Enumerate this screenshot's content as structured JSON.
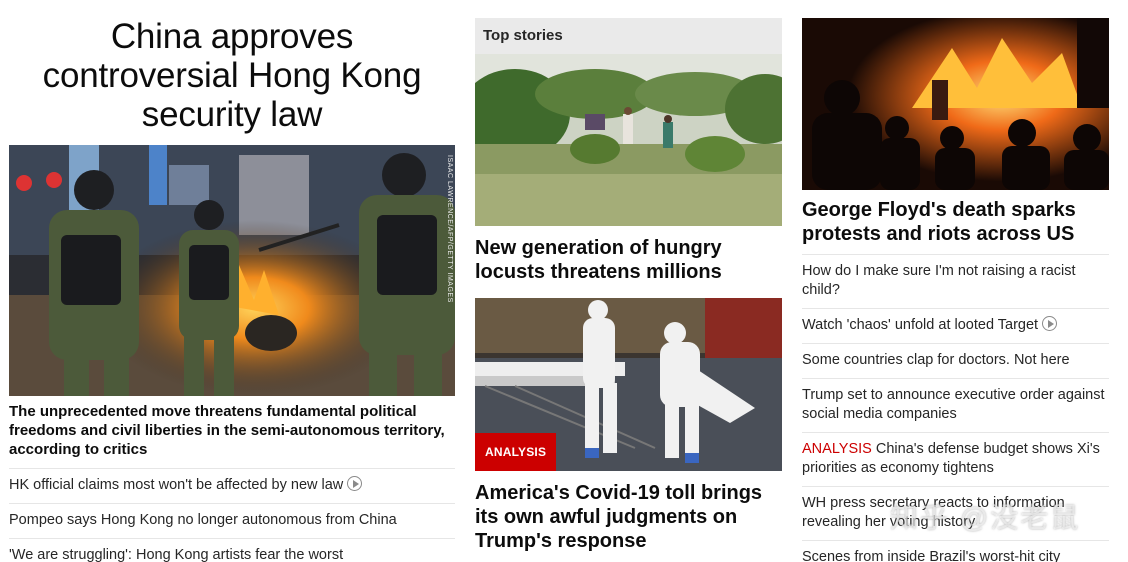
{
  "lead": {
    "headline": "China approves controversial Hong Kong security law",
    "photo_credit": "ISAAC LAWRENCE/AFP/GETTY IMAGES",
    "summary": "The unprecedented move threatens fundamental political freedoms and civil liberties in the semi-autonomous territory, according to critics",
    "links": [
      {
        "text": "HK official claims most won't be affected by new law",
        "video": true
      },
      {
        "text": "Pompeo says Hong Kong no longer autonomous from China",
        "video": false
      },
      {
        "text": "'We are struggling': Hong Kong artists fear the worst",
        "video": false
      }
    ]
  },
  "top_stories": {
    "label": "Top stories",
    "cards": [
      {
        "title": "New generation of hungry locusts threatens millions",
        "badge": ""
      },
      {
        "title": "America's Covid-19 toll brings its own awful judgments on Trump's response",
        "badge": "ANALYSIS"
      }
    ]
  },
  "right": {
    "title": "George Floyd's death sparks protests and riots across US",
    "links": [
      {
        "prefix": "",
        "text": "How do I make sure I'm not raising a racist child?",
        "video": false
      },
      {
        "prefix": "",
        "text": "Watch 'chaos' unfold at looted Target",
        "video": true
      },
      {
        "prefix": "",
        "text": "Some countries clap for doctors. Not here",
        "video": false
      },
      {
        "prefix": "",
        "text": "Trump set to announce executive order against social media companies",
        "video": false
      },
      {
        "prefix": "ANALYSIS",
        "text": "China's defense budget shows Xi's priorities as economy tightens",
        "video": false
      },
      {
        "prefix": "",
        "text": "WH press secretary reacts to information revealing her voting history",
        "video": false
      },
      {
        "prefix": "",
        "text": "Scenes from inside Brazil's worst-hit city",
        "video": false
      }
    ]
  },
  "watermark": "知乎 @没老鼠",
  "colors": {
    "accent_red": "#cc0000",
    "divider": "#e6e6e6",
    "section_bar": "#eaeaea"
  }
}
